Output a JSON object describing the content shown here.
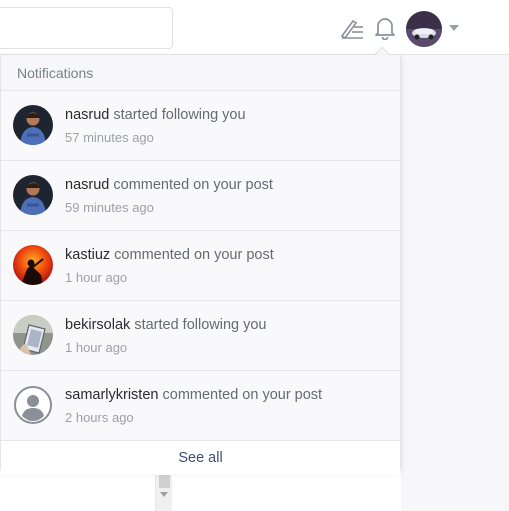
{
  "topbar": {
    "search": {
      "placeholder": "",
      "value": ""
    },
    "icons": [
      "write-icon",
      "bell-icon",
      "avatar",
      "caret-down-icon"
    ]
  },
  "notifications": {
    "header": "Notifications",
    "items": [
      {
        "user": "nasrud",
        "action": "started following you",
        "time": "57 minutes ago",
        "avatar": "man-blue-shirt"
      },
      {
        "user": "nasrud",
        "action": "commented on your post",
        "time": "59 minutes ago",
        "avatar": "man-blue-shirt"
      },
      {
        "user": "kastiuz",
        "action": "commented on your post",
        "time": "1 hour ago",
        "avatar": "red-sunset-silhouette"
      },
      {
        "user": "bekirsolak",
        "action": "started following you",
        "time": "1 hour ago",
        "avatar": "phone-photo"
      },
      {
        "user": "samarlykristen",
        "action": "commented on your post",
        "time": "2 hours ago",
        "avatar": "default-user-icon"
      }
    ],
    "see_all": "See all"
  },
  "colors": {
    "accent_link": "#3d4f7a",
    "muted_text": "#9da1a8",
    "username_text": "#2b2b30"
  }
}
